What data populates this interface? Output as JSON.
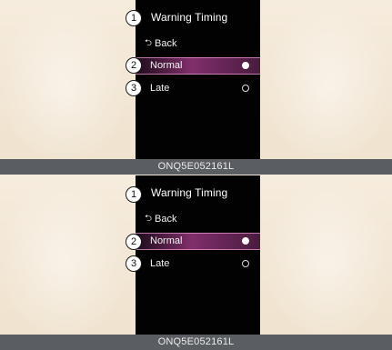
{
  "panels": [
    {
      "callouts": [
        "1",
        "2",
        "3"
      ],
      "title": "Warning Timing",
      "back": {
        "icon": "back-arrow-icon",
        "label": "Back"
      },
      "options": [
        {
          "label": "Normal",
          "selected": true
        },
        {
          "label": "Late",
          "selected": false
        }
      ],
      "caption": "ONQ5E052161L"
    },
    {
      "callouts": [
        "1",
        "2",
        "3"
      ],
      "title": "Warning Timing",
      "back": {
        "icon": "back-arrow-icon",
        "label": "Back"
      },
      "options": [
        {
          "label": "Normal",
          "selected": true
        },
        {
          "label": "Late",
          "selected": false
        }
      ],
      "caption": "ONQ5E052161L"
    }
  ],
  "colors": {
    "screen_background": "#020202",
    "selected_highlight": "#a83b8e",
    "caption_bar": "#5a5d61",
    "page_background": "#f4ead9"
  }
}
